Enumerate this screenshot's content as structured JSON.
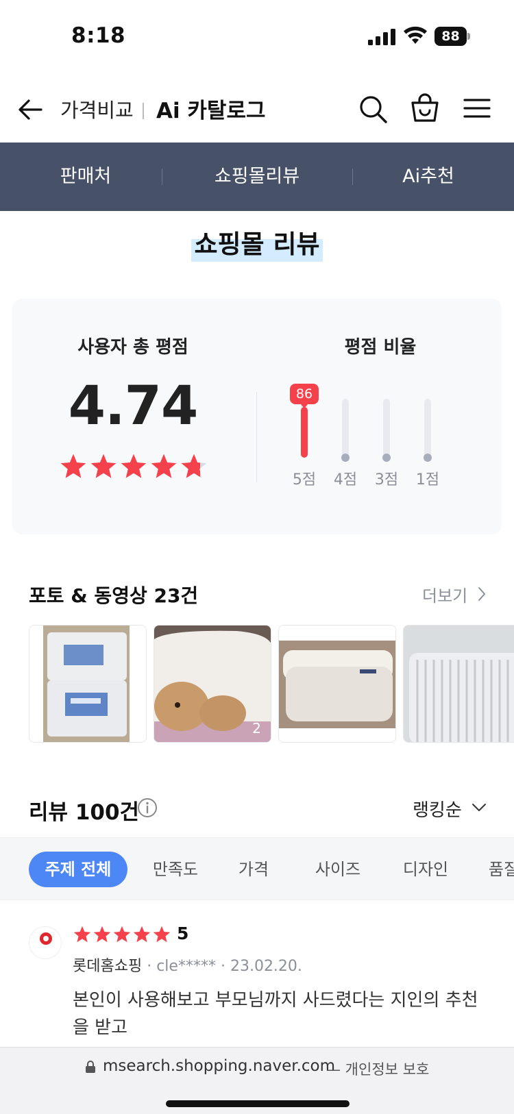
{
  "status": {
    "time": "8:18",
    "battery": "88"
  },
  "header": {
    "price_compare": "가격비교",
    "catalog": "Ai 카탈로그"
  },
  "tabs": [
    {
      "label": "판매처"
    },
    {
      "label": "쇼핑몰리뷰"
    },
    {
      "label": "Ai추천"
    }
  ],
  "section_title": "쇼핑몰 리뷰",
  "rating": {
    "avg_label": "사용자 총 평점",
    "avg_score": "4.74",
    "avg_value": 4.74,
    "ratio_label": "평점 비율",
    "bars": [
      {
        "label": "5점",
        "percent": 86,
        "badge": "86"
      },
      {
        "label": "4점",
        "percent": 0
      },
      {
        "label": "3점",
        "percent": 0
      },
      {
        "label": "1점",
        "percent": 0
      }
    ]
  },
  "photos": {
    "title": "포토 & 동영상 23건",
    "more_label": "더보기",
    "items": [
      {
        "name": "photo-pillow-packages"
      },
      {
        "name": "photo-dog-on-pillow",
        "count": "2"
      },
      {
        "name": "photo-pillows-on-bed"
      },
      {
        "name": "photo-striped-pillow"
      }
    ]
  },
  "reviews": {
    "count_label": "리뷰 100건",
    "sort_label": "랭킹순",
    "topics": [
      "주제 전체",
      "만족도",
      "가격",
      "사이즈",
      "디자인",
      "품질"
    ],
    "items": [
      {
        "stars": 5,
        "score": "5",
        "shop": "롯데홈쇼핑",
        "shop_logo_text": "롯데홈쇼핑",
        "user": "cle*****",
        "date": "23.02.20.",
        "body": "본인이 사용해보고 부모님까지 사드렸다는 지인의 추천을 받고"
      }
    ]
  },
  "url_bar": {
    "url": "msearch.shopping.naver.com",
    "secure_label": "— 개인정보 보호"
  },
  "colors": {
    "nav_bg": "#475167",
    "accent_red": "#f5414c",
    "chip_active": "#4d86f5"
  }
}
